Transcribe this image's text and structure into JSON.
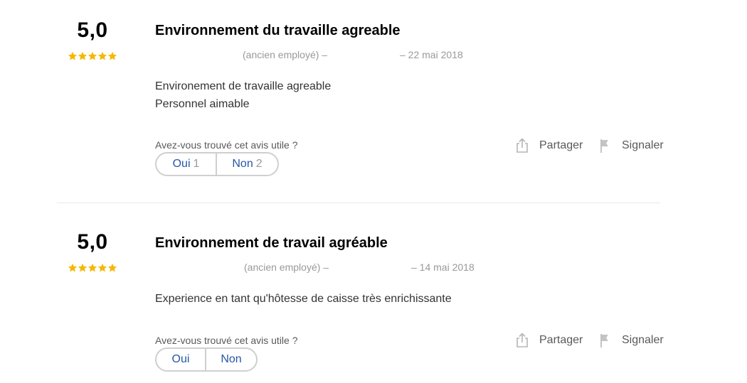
{
  "reviews": [
    {
      "score": "5,0",
      "stars": 5,
      "title": "Environnement du travaille agreable",
      "role": "(ancien employé) –",
      "date": "– 22 mai 2018",
      "body_lines": [
        "Environement de travaille agreable",
        "Personnel aimable"
      ],
      "helpful_question": "Avez-vous trouvé cet avis utile ?",
      "yes_label": "Oui",
      "yes_count": "1",
      "no_label": "Non",
      "no_count": "2",
      "share_label": "Partager",
      "report_label": "Signaler"
    },
    {
      "score": "5,0",
      "stars": 5,
      "title": "Environnement de travail agréable",
      "role": "(ancien employé) –",
      "date": "– 14 mai 2018",
      "body_lines": [
        "Experience en tant qu'hôtesse de caisse très enrichissante"
      ],
      "helpful_question": "Avez-vous trouvé cet avis utile ?",
      "yes_label": "Oui",
      "no_label": "Non",
      "share_label": "Partager",
      "report_label": "Signaler"
    }
  ],
  "colors": {
    "star": "#f5b800",
    "link": "#2557a7",
    "muted": "#999999",
    "border": "#cfcfcf"
  },
  "icons": {
    "rating": "star-icon",
    "share": "share-icon",
    "report": "flag-icon"
  }
}
